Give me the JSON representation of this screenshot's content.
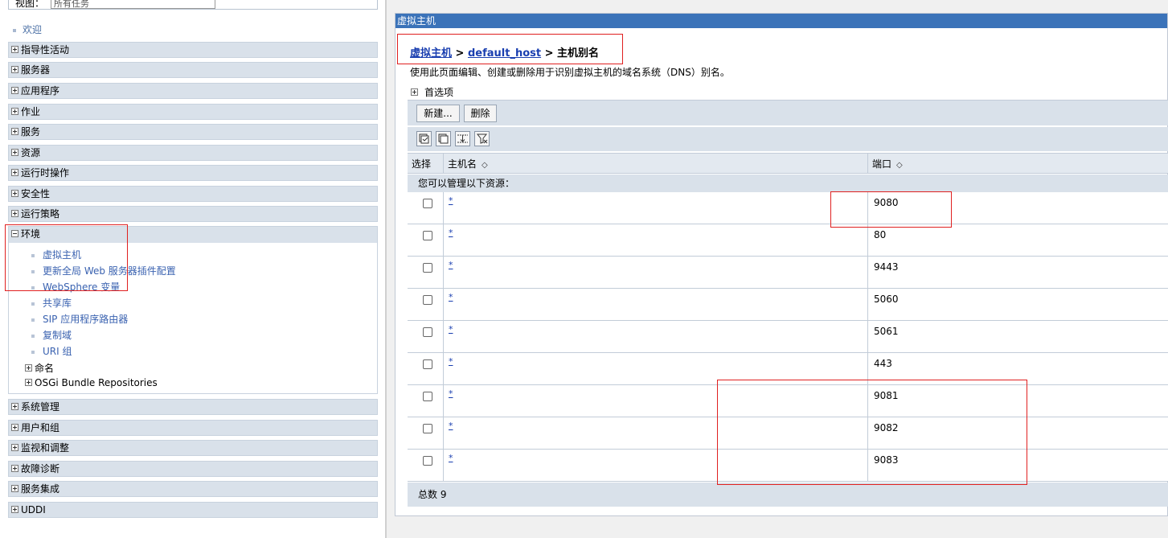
{
  "nav": {
    "view_label": "视图：",
    "view_value": "所有任务",
    "welcome": "欢迎",
    "items_top": [
      "指导性活动",
      "服务器",
      "应用程序",
      "作业",
      "服务",
      "资源",
      "运行时操作",
      "安全性",
      "运行策略"
    ],
    "env": {
      "label": "环境",
      "links": [
        "虚拟主机",
        "更新全局 Web 服务器插件配置",
        "WebSphere 变量",
        "共享库",
        "SIP 应用程序路由器",
        "复制域",
        "URI 组"
      ],
      "groups": [
        "命名",
        "OSGi Bundle Repositories"
      ]
    },
    "items_bottom": [
      "系统管理",
      "用户和组",
      "监视和调整",
      "故障诊断",
      "服务集成",
      "UDDI"
    ]
  },
  "content": {
    "title": "虚拟主机",
    "breadcrumb": {
      "part1": "虚拟主机",
      "sep1": " > ",
      "part2": "default_host",
      "sep2": " > ",
      "part3": "主机别名"
    },
    "description": "使用此页面编辑、创建或删除用于识别虚拟主机的域名系统（DNS）别名。",
    "preferences": "首选项",
    "buttons": {
      "new": "新建...",
      "delete": "删除"
    },
    "toolbar_icons": [
      "select-all-icon",
      "deselect-all-icon",
      "show-filter-icon",
      "clear-filter-icon"
    ],
    "table": {
      "columns": {
        "select": "选择",
        "host": "主机名",
        "port": "端口"
      },
      "resource_note": "您可以管理以下资源：",
      "rows": [
        {
          "host": "*",
          "port": "9080"
        },
        {
          "host": "*",
          "port": "80"
        },
        {
          "host": "*",
          "port": "9443"
        },
        {
          "host": "*",
          "port": "5060"
        },
        {
          "host": "*",
          "port": "5061"
        },
        {
          "host": "*",
          "port": "443"
        },
        {
          "host": "*",
          "port": "9081"
        },
        {
          "host": "*",
          "port": "9082"
        },
        {
          "host": "*",
          "port": "9083"
        }
      ],
      "total": "总数 9"
    }
  },
  "colors": {
    "title_bar": "#3b73b9",
    "link": "#1a3fb0",
    "annotation": "#e02020"
  }
}
